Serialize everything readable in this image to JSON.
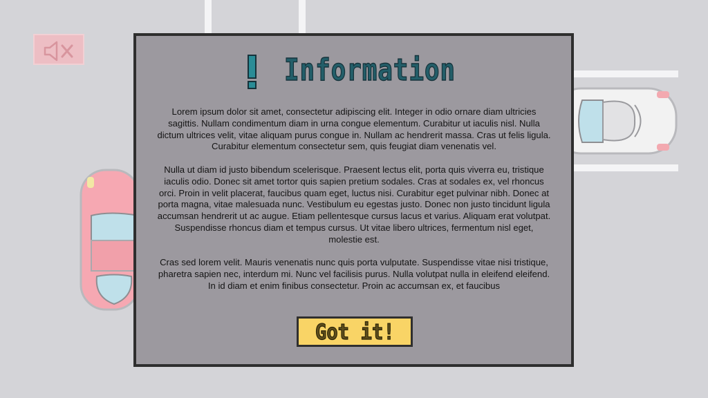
{
  "colors": {
    "background": "#d4d4d8",
    "dialog_fill": "#9c999f",
    "dialog_border": "#2e2e2e",
    "title_color": "#235e69",
    "button_fill": "#f9d466"
  },
  "mute_button": {
    "icon": "speaker-muted-icon"
  },
  "dialog": {
    "title_icon": "exclamation-icon",
    "title": "Information",
    "paragraphs": [
      "Lorem ipsum dolor sit amet, consectetur adipiscing elit. Integer in odio ornare diam ultricies sagittis. Nullam condimentum diam in urna congue elementum. Curabitur ut iaculis nisl. Nulla dictum ultrices velit, vitae aliquam purus congue in. Nullam ac hendrerit massa. Cras ut felis ligula. Curabitur elementum consectetur sem, quis feugiat diam venenatis vel.",
      "Nulla ut diam id justo bibendum scelerisque. Praesent lectus elit, porta quis viverra eu, tristique iaculis odio. Donec sit amet tortor quis sapien pretium sodales. Cras at sodales ex, vel rhoncus orci. Proin in velit placerat, faucibus quam eget, luctus nisi. Curabitur eget pulvinar nibh. Donec at porta magna, vitae malesuada nunc. Vestibulum eu egestas justo. Donec non justo tincidunt ligula accumsan hendrerit ut ac augue. Etiam pellentesque cursus lacus et varius. Aliquam erat volutpat. Suspendisse rhoncus diam et tempus cursus. Ut vitae libero ultrices, fermentum nisl eget, molestie est.",
      "Cras sed lorem velit. Mauris venenatis nunc quis porta vulputate. Suspendisse vitae nisi tristique, pharetra sapien nec, interdum mi. Nunc vel facilisis purus. Nulla volutpat nulla in eleifend eleifend. In id diam et enim finibus consectetur. Proin ac accumsan ex, et faucibus"
    ],
    "button_label": "Got it!"
  }
}
